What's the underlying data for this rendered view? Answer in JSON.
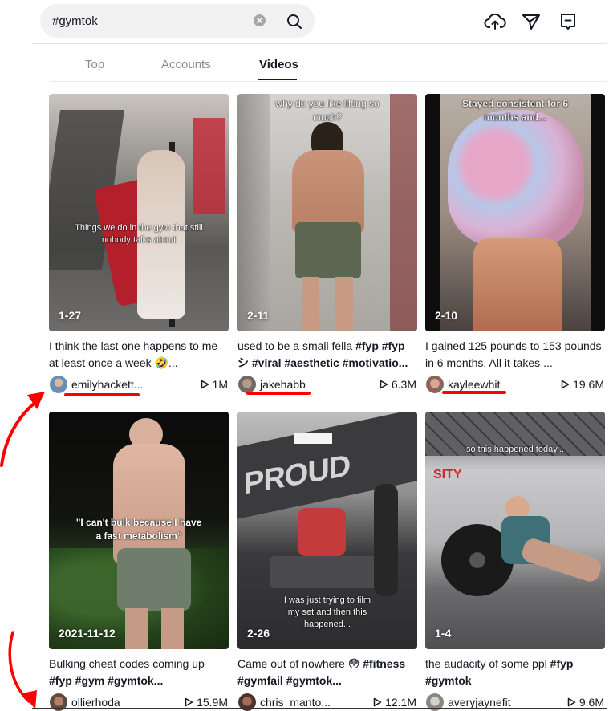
{
  "search": {
    "value": "#gymtok",
    "clear_icon": "clear-x-circle-icon",
    "search_icon": "magnifier-icon"
  },
  "header_icons": [
    {
      "name": "upload-cloud-icon",
      "label": "Upload"
    },
    {
      "name": "send-paper-plane-icon",
      "label": "Messages"
    },
    {
      "name": "inbox-message-icon",
      "label": "Inbox"
    }
  ],
  "tabs": [
    {
      "label": "Top",
      "active": false
    },
    {
      "label": "Accounts",
      "active": false
    },
    {
      "label": "Videos",
      "active": true
    }
  ],
  "videos": [
    {
      "overlay_text": "Things we do in the gym that still nobody talks about",
      "date": "1-27",
      "caption_plain": "I think the last one happens to me at least once a week 🤣...",
      "caption_tags": "",
      "author": "emilyhackett...",
      "views": "1M",
      "annotated": true
    },
    {
      "overlay_text": "why do you like lifting so much?",
      "date": "2-11",
      "caption_plain": "used to be a small fella ",
      "caption_tags": "#fyp #fyp シ #viral #aesthetic #motivatio...",
      "author": "jakehabb",
      "views": "6.3M",
      "annotated": true
    },
    {
      "overlay_text": "Stayed consistent for 6 months and...",
      "date": "2-10",
      "caption_plain": "I gained 125 pounds to 153 pounds in 6 months. All it takes ...",
      "caption_tags": "",
      "author": "kayleewhit",
      "views": "19.6M",
      "annotated": true
    },
    {
      "overlay_text": "\"I can't bulk because I have a fast metabolism\"",
      "date": "2021-11-12",
      "caption_plain": "Bulking cheat codes coming up ",
      "caption_tags": "#fyp #gym #gymtok...",
      "author": "ollierhoda",
      "views": "15.9M",
      "annotated": false
    },
    {
      "overlay_text": "I was just trying to film my set and then this happened...",
      "date": "2-26",
      "caption_plain": "Came out of nowhere 😳 ",
      "caption_tags": "#fitness #gymfail #gymtok...",
      "author": "chris_manto...",
      "views": "12.1M",
      "annotated": false
    },
    {
      "overlay_text": "so this happened today...",
      "date": "1-4",
      "caption_plain": "the audacity of some ppl ",
      "caption_tags": "#fyp #gymtok",
      "author": "averyjaynefit",
      "views": "9.6M",
      "annotated": false
    }
  ],
  "colors": {
    "annotation_red": "#ff0000",
    "text_primary": "#161823",
    "tab_inactive": "#8a8b91",
    "search_bg": "#f1f1f2"
  }
}
